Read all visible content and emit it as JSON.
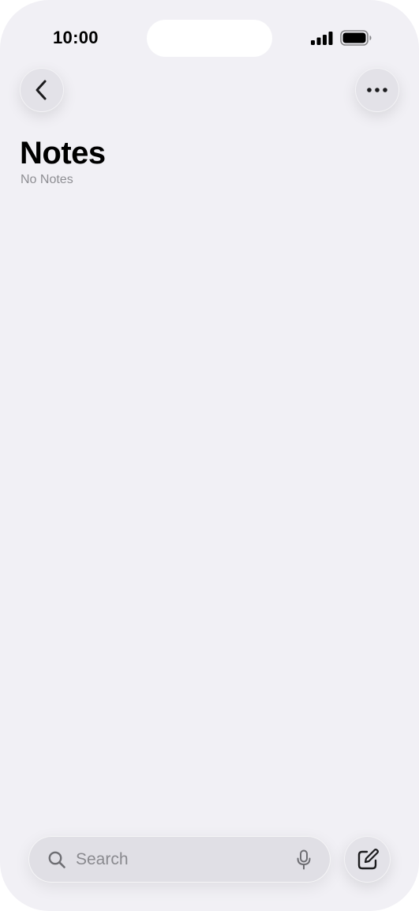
{
  "status_bar": {
    "time": "10:00"
  },
  "header": {
    "back_icon": "chevron-left-icon",
    "more_icon": "ellipsis-icon"
  },
  "main": {
    "title": "Notes",
    "subtitle": "No Notes"
  },
  "bottom_bar": {
    "search_placeholder": "Search",
    "search_icon": "magnifier-icon",
    "mic_icon": "microphone-icon",
    "compose_icon": "compose-icon"
  },
  "colors": {
    "background": "#f1f0f5",
    "control_fill": "#e3e2e8",
    "secondary_text": "#8e8e93"
  }
}
